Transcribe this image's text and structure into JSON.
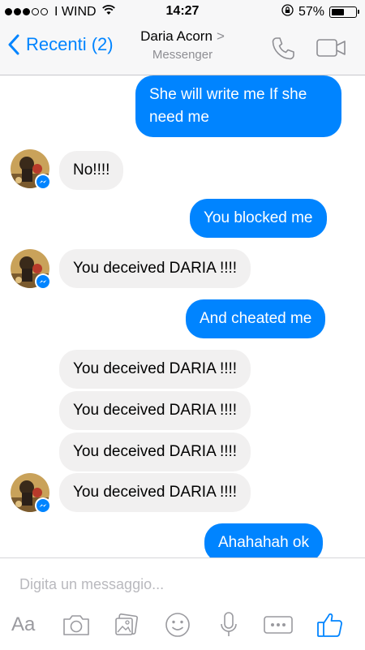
{
  "status_bar": {
    "carrier": "I WIND",
    "signal_filled": 3,
    "signal_total": 5,
    "time": "14:27",
    "battery": "57%",
    "battery_level": 0.57
  },
  "header": {
    "back_label": "Recenti (2)",
    "contact_name": "Daria Acorn",
    "chevron": ">",
    "subtitle": "Messenger"
  },
  "messages": [
    {
      "from": "me",
      "text": "She will write me If she need me"
    },
    {
      "from": "them",
      "text": "No!!!!"
    },
    {
      "from": "me",
      "text": "You blocked me"
    },
    {
      "from": "them",
      "text": "You deceived DARIA !!!!"
    },
    {
      "from": "me",
      "text": "And cheated me"
    },
    {
      "from": "them",
      "text": "You deceived DARIA !!!!"
    },
    {
      "from": "them",
      "text": "You deceived DARIA !!!!"
    },
    {
      "from": "them",
      "text": "You deceived DARIA !!!!"
    },
    {
      "from": "them",
      "text": "You deceived DARIA !!!!"
    },
    {
      "from": "me",
      "text": "Ahahahah ok"
    }
  ],
  "composer": {
    "placeholder": "Digita un messaggio...",
    "aa_label": "Aa"
  },
  "colors": {
    "accent": "#0084ff",
    "incoming_bubble": "#f1f0f0",
    "toolbar_icon": "#9a9a9f"
  },
  "icons": [
    "back-chevron-icon",
    "phone-icon",
    "video-call-icon",
    "camera-icon",
    "gallery-icon",
    "emoji-icon",
    "microphone-icon",
    "more-icon",
    "like-thumb-icon",
    "messenger-badge-icon"
  ]
}
